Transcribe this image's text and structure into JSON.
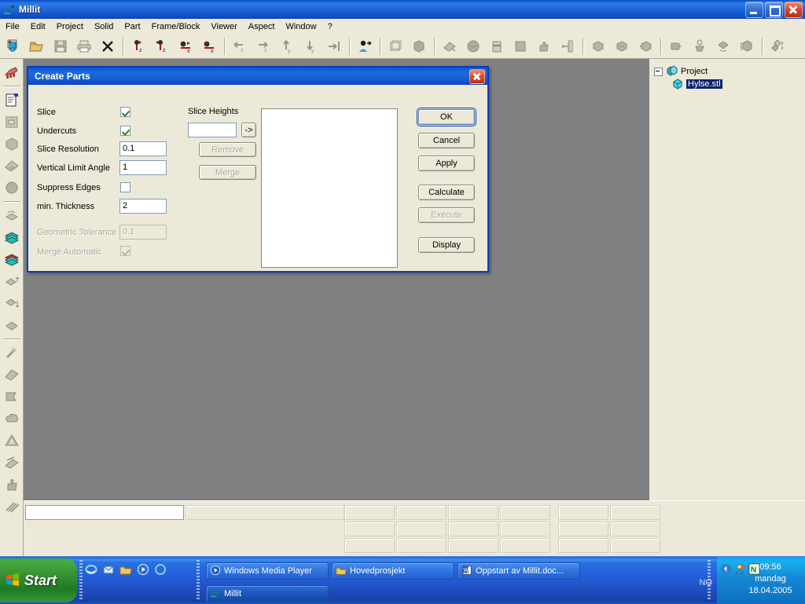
{
  "window": {
    "title": "Millit",
    "icon": "millit-app-icon",
    "buttons": {
      "minimize": "Minimize",
      "maximize": "Maximize",
      "close": "Close"
    }
  },
  "menubar": {
    "items": [
      {
        "label": "File"
      },
      {
        "label": "Edit"
      },
      {
        "label": "Project"
      },
      {
        "label": "Solid"
      },
      {
        "label": "Part"
      },
      {
        "label": "Frame/Block"
      },
      {
        "label": "Viewer"
      },
      {
        "label": "Aspect"
      },
      {
        "label": "Window"
      },
      {
        "label": "?"
      }
    ]
  },
  "toolbar": {
    "groups": [
      {
        "buttons": [
          {
            "icon": "new-project-icon"
          },
          {
            "icon": "open-folder-icon"
          },
          {
            "icon": "save-disk-icon"
          },
          {
            "icon": "print-icon"
          },
          {
            "icon": "delete-cross-icon"
          }
        ]
      },
      {
        "buttons": [
          {
            "icon": "rotate-z-positive-icon"
          },
          {
            "icon": "rotate-z-negative-icon"
          },
          {
            "icon": "rotate-x-positive-icon"
          },
          {
            "icon": "rotate-x-negative-icon"
          }
        ]
      },
      {
        "buttons": [
          {
            "icon": "move-x-left-icon"
          },
          {
            "icon": "move-x-right-icon"
          },
          {
            "icon": "move-y-up-icon"
          },
          {
            "icon": "move-y-down-icon"
          },
          {
            "icon": "align-right-icon"
          }
        ]
      },
      {
        "buttons": [
          {
            "icon": "view-person-icon"
          }
        ]
      },
      {
        "buttons": [
          {
            "icon": "wireframe-box-icon"
          },
          {
            "icon": "shaded-solid-icon"
          }
        ]
      },
      {
        "buttons": [
          {
            "icon": "slice-part-icon"
          },
          {
            "icon": "create-part-icon"
          },
          {
            "icon": "part-stack-icon"
          },
          {
            "icon": "block-fill-icon"
          },
          {
            "icon": "thumb-part-icon"
          },
          {
            "icon": "measure-scale-icon"
          }
        ]
      },
      {
        "buttons": [
          {
            "icon": "part-copy-icon"
          },
          {
            "icon": "part-paste-icon"
          },
          {
            "icon": "part-merge-icon"
          }
        ]
      },
      {
        "buttons": [
          {
            "icon": "part-shadow-icon"
          },
          {
            "icon": "part-light-icon"
          },
          {
            "icon": "part-rotate-icon"
          },
          {
            "icon": "part-mirror-icon"
          }
        ]
      },
      {
        "buttons": [
          {
            "icon": "arrange-parts-icon"
          }
        ]
      }
    ]
  },
  "left_toolbar": {
    "groups": [
      {
        "buttons": [
          {
            "icon": "new-document-stack-icon"
          }
        ]
      },
      {
        "buttons": [
          {
            "icon": "document-flag-icon"
          },
          {
            "icon": "import-file-icon"
          },
          {
            "icon": "solid-shape-icon"
          },
          {
            "icon": "shade-solid-icon"
          },
          {
            "icon": "sphere-icon"
          }
        ]
      },
      {
        "buttons": [
          {
            "icon": "slice-tool-icon"
          },
          {
            "icon": "layer-stack-green-icon"
          },
          {
            "icon": "layer-stack-red-icon"
          },
          {
            "icon": "part-move-up-icon"
          },
          {
            "icon": "part-move-down-icon"
          },
          {
            "icon": "part-tool-icon"
          }
        ]
      },
      {
        "buttons": [
          {
            "icon": "magic-wand-icon"
          },
          {
            "icon": "polygon-tool-icon"
          },
          {
            "icon": "flag-marker-icon"
          },
          {
            "icon": "cloud-shape-icon"
          },
          {
            "icon": "triangle-warning-icon"
          },
          {
            "icon": "cut-tool-icon"
          },
          {
            "icon": "thumb-icon"
          },
          {
            "icon": "hatch-pattern-icon"
          }
        ]
      }
    ]
  },
  "project_tree": {
    "root": {
      "label": "Project",
      "icon": "project-icon",
      "expanded": true
    },
    "children": [
      {
        "label": "Hylse.stl",
        "icon": "stl-part-icon",
        "selected": true
      }
    ]
  },
  "dialog": {
    "title": "Create Parts",
    "close_label": "Close",
    "fields": [
      {
        "name": "slice",
        "label": "Slice",
        "type": "checkbox",
        "checked": true,
        "enabled": true
      },
      {
        "name": "undercuts",
        "label": "Undercuts",
        "type": "checkbox",
        "checked": true,
        "enabled": true
      },
      {
        "name": "slice-resolution",
        "label": "Slice Resolution",
        "type": "text",
        "value": "0.1",
        "enabled": true
      },
      {
        "name": "vertical-limit-angle",
        "label": "Vertical Limit Angle",
        "type": "text",
        "value": "1",
        "enabled": true
      },
      {
        "name": "suppress-edges",
        "label": "Suppress Edges",
        "type": "checkbox",
        "checked": false,
        "enabled": true
      },
      {
        "name": "min-thickness",
        "label": "min. Thickness",
        "type": "text",
        "value": "2",
        "enabled": true
      },
      {
        "name": "geometric-tolerance",
        "label": "Geometric Tolerance",
        "type": "text",
        "value": "0.1",
        "enabled": false
      },
      {
        "name": "merge-automatic",
        "label": "Merge Automatic",
        "type": "checkbox",
        "checked": true,
        "enabled": false
      }
    ],
    "slice_heights": {
      "group_label": "Slice Heights",
      "input_value": "",
      "add_button_label": "->",
      "remove_button_label": "Remove",
      "merge_button_label": "Merge",
      "list_items": []
    },
    "action_buttons": [
      {
        "name": "ok",
        "label": "OK",
        "enabled": true,
        "default": true
      },
      {
        "name": "cancel",
        "label": "Cancel",
        "enabled": true,
        "default": false
      },
      {
        "name": "apply",
        "label": "Apply",
        "enabled": true,
        "default": false
      },
      {
        "name": "calculate",
        "label": "Calculate",
        "enabled": true,
        "default": false
      },
      {
        "name": "execute",
        "label": "Execute",
        "enabled": false,
        "default": false
      },
      {
        "name": "display",
        "label": "Display",
        "enabled": true,
        "default": false
      }
    ]
  },
  "status_bar": {
    "input_value": "",
    "cells": []
  },
  "taskbar": {
    "start_label": "Start",
    "quick_launch": [
      {
        "icon": "internet-explorer-icon"
      },
      {
        "icon": "outlook-express-icon"
      },
      {
        "icon": "show-desktop-icon"
      },
      {
        "icon": "media-player-icon"
      },
      {
        "icon": "msn-icon"
      }
    ],
    "tasks": [
      {
        "label": "Windows Media Player",
        "icon": "media-player-icon",
        "active": false
      },
      {
        "label": "Hovedprosjekt",
        "icon": "folder-icon",
        "active": false
      },
      {
        "label": "Oppstart av Millit.doc...",
        "icon": "word-icon",
        "active": false
      },
      {
        "label": "Millit",
        "icon": "millit-app-icon",
        "active": true
      }
    ],
    "tray": {
      "locale": "NO",
      "icons": [
        "volume-icon",
        "user-account-icon",
        "norton-icon"
      ],
      "time": "09:56",
      "day": "mandag",
      "date": "18.04.2005"
    }
  },
  "colors": {
    "title_blue": "#0f57cc",
    "face": "#ece9d8",
    "viewport": "#808080",
    "selection": "#0a246a",
    "check_green": "#2f7a2f"
  }
}
